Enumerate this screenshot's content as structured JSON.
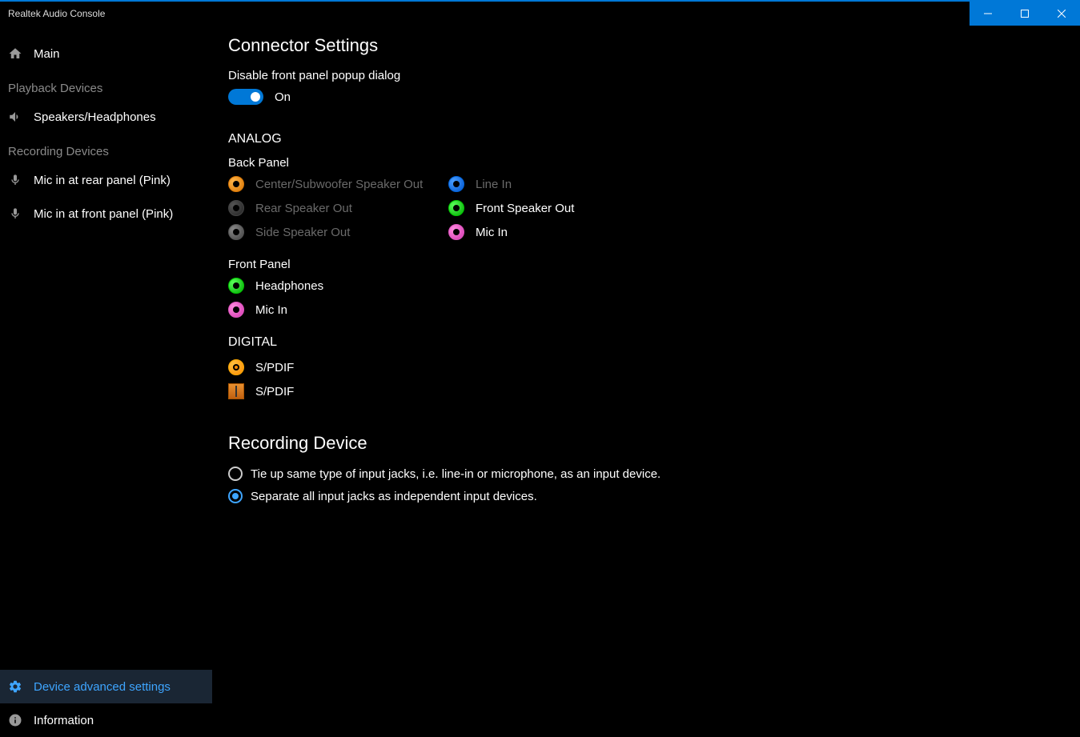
{
  "window": {
    "title": "Realtek Audio Console"
  },
  "sidebar": {
    "main": "Main",
    "playback_header": "Playback Devices",
    "speakers": "Speakers/Headphones",
    "recording_header": "Recording Devices",
    "mic_rear": "Mic in at rear panel (Pink)",
    "mic_front": "Mic in at front panel (Pink)",
    "advanced": "Device advanced settings",
    "info": "Information"
  },
  "main": {
    "title": "Connector Settings",
    "disable_popup": "Disable front panel popup dialog",
    "toggle_state": "On",
    "analog": "ANALOG",
    "back_panel": "Back Panel",
    "jacks_back_left": {
      "center": "Center/Subwoofer Speaker Out",
      "rear": "Rear Speaker Out",
      "side": "Side Speaker Out"
    },
    "jacks_back_right": {
      "linein": "Line In",
      "front_speaker": "Front Speaker Out",
      "micin": "Mic In"
    },
    "front_panel": "Front Panel",
    "jacks_front": {
      "headphones": "Headphones",
      "micin": "Mic In"
    },
    "digital": "DIGITAL",
    "spdif1": "S/PDIF",
    "spdif2": "S/PDIF",
    "rec_title": "Recording Device",
    "rec_opt1": "Tie up same type of input jacks, i.e. line-in or microphone, as an input device.",
    "rec_opt2": "Separate all input jacks as independent input devices."
  }
}
